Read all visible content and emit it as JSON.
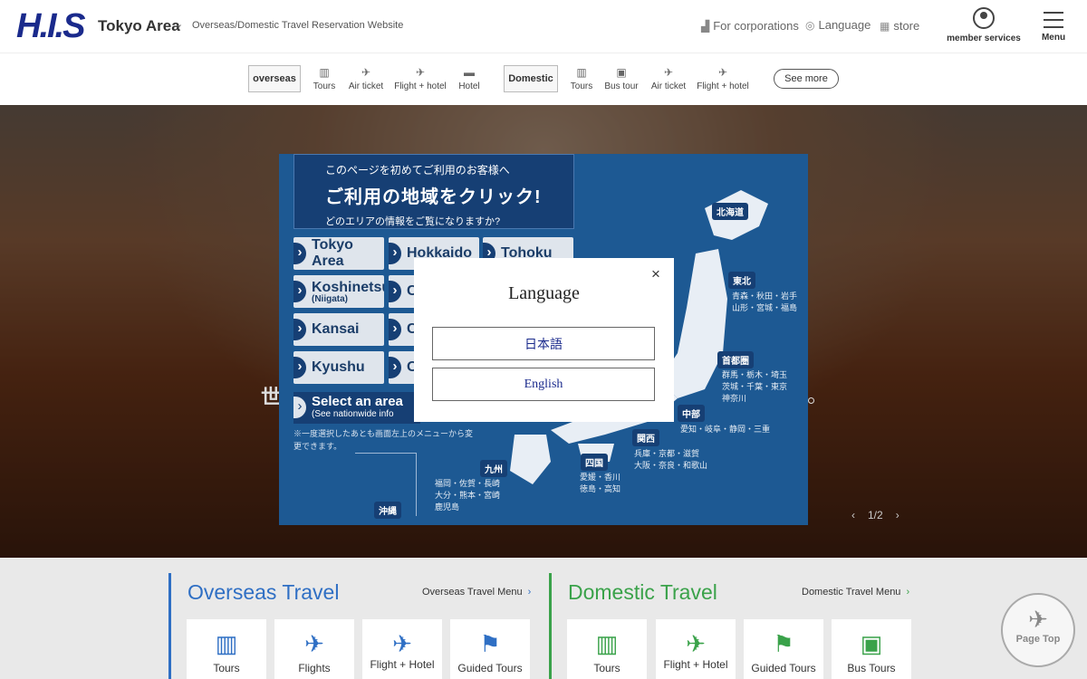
{
  "header": {
    "logo": "H.I.S",
    "area_title": "Tokyo Area",
    "tagline": "Overseas/Domestic Travel Reservation Website",
    "links": [
      {
        "label": "For corporations",
        "icon": "building-icon"
      },
      {
        "label": "Language",
        "icon": "globe-icon"
      },
      {
        "label": "store",
        "icon": "store-icon"
      }
    ],
    "member_label": "member services",
    "menu_label": "Menu"
  },
  "subnav": {
    "overseas_label": "overseas",
    "overseas_items": [
      "Tours",
      "Air ticket",
      "Flight + hotel",
      "Hotel"
    ],
    "domestic_label": "Domestic",
    "domestic_items": [
      "Tours",
      "Bus tour",
      "Air ticket",
      "Flight + hotel"
    ],
    "see_more": "See more"
  },
  "hero": {
    "overlay_text": "世",
    "counter": "1/2"
  },
  "banner": {
    "line1": "このページを初めてご利用のお客様へ",
    "line2": "ご利用の地域をクリック!",
    "line3": "どのエリアの情報をご覧になりますか?",
    "regions": [
      {
        "label": "Tokyo Area"
      },
      {
        "label": "Hokkaido"
      },
      {
        "label": "Tohoku"
      },
      {
        "label": "Koshinetsu",
        "sub": "(Niigata)"
      },
      {
        "label": "C"
      },
      {
        "label": "Kansai"
      },
      {
        "label": "C"
      },
      {
        "label": "Kyushu"
      },
      {
        "label": "O"
      }
    ],
    "select_area": "Select an area",
    "select_area_sub": "(See nationwide info",
    "note": "※一度選択したあとも画面左上のメニューから変更できます。",
    "map_labels": {
      "hokkaido": "北海道",
      "tohoku": "東北",
      "tohoku_prefs": "青森・秋田・岩手\n山形・宮城・福島",
      "shutoken": "首都圏",
      "shutoken_prefs": "群馬・栃木・埼玉\n茨城・千葉・東京\n神奈川",
      "chubu": "中部",
      "chubu_prefs": "愛知・岐阜・静岡・三重",
      "kansai": "関西",
      "kansai_prefs": "兵庫・京都・滋賀\n大阪・奈良・和歌山",
      "shikoku": "四国",
      "shikoku_prefs": "愛媛・香川\n徳島・高知",
      "kyushu": "九州",
      "kyushu_prefs": "福岡・佐賀・長崎\n大分・熊本・宮崎\n鹿児島",
      "okinawa": "沖縄"
    }
  },
  "modal": {
    "title": "Language",
    "close": "×",
    "options": [
      "日本語",
      "English"
    ]
  },
  "overseas": {
    "title": "Overseas Travel",
    "menu_link": "Overseas Travel Menu",
    "cards": [
      {
        "label": "Tours",
        "icon": "suitcase-icon"
      },
      {
        "label": "Flights",
        "icon": "plane-icon"
      },
      {
        "label": "Flight + Hotel",
        "icon": "flight-hotel-icon"
      },
      {
        "label": "Guided Tours",
        "icon": "flag-icon"
      }
    ]
  },
  "domestic": {
    "title": "Domestic Travel",
    "menu_link": "Domestic Travel Menu",
    "cards": [
      {
        "label": "Tours",
        "icon": "suitcase-icon"
      },
      {
        "label": "Flight + Hotel",
        "icon": "flight-hotel-icon"
      },
      {
        "label": "Guided Tours",
        "icon": "flag-icon"
      },
      {
        "label": "Bus Tours",
        "icon": "bus-icon"
      }
    ]
  },
  "page_top": "Page Top",
  "colors": {
    "brand": "#1a2a8c",
    "overseas_accent": "#2f6fc4",
    "domestic_accent": "#3aa24a",
    "banner_blue": "#1d5993"
  }
}
